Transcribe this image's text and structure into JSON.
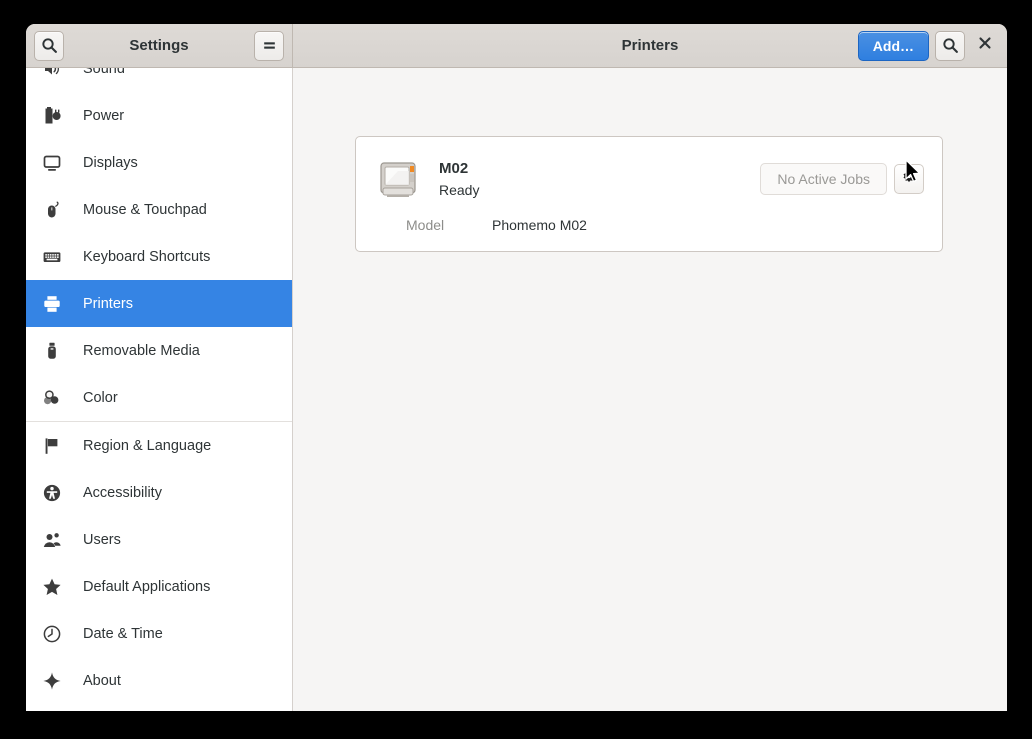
{
  "window": {
    "left_header_title": "Settings",
    "right_header_title": "Printers"
  },
  "header": {
    "search_icon": "search-icon",
    "menu_icon": "hamburger-menu-icon",
    "add_label": "Add…",
    "content_search_icon": "search-icon",
    "close_icon": "close-icon"
  },
  "sidebar": {
    "items": [
      {
        "label": "Sound",
        "icon": "speaker-icon",
        "selected": false
      },
      {
        "label": "Power",
        "icon": "power-plug-icon",
        "selected": false
      },
      {
        "label": "Displays",
        "icon": "monitor-icon",
        "selected": false
      },
      {
        "label": "Mouse & Touchpad",
        "icon": "mouse-icon",
        "selected": false
      },
      {
        "label": "Keyboard Shortcuts",
        "icon": "keyboard-icon",
        "selected": false
      },
      {
        "label": "Printers",
        "icon": "printer-icon",
        "selected": true
      },
      {
        "label": "Removable Media",
        "icon": "usb-drive-icon",
        "selected": false
      },
      {
        "label": "Color",
        "icon": "color-circles-icon",
        "selected": false
      },
      {
        "label": "Region & Language",
        "icon": "flag-icon",
        "selected": false
      },
      {
        "label": "Accessibility",
        "icon": "accessibility-icon",
        "selected": false
      },
      {
        "label": "Users",
        "icon": "users-icon",
        "selected": false
      },
      {
        "label": "Default Applications",
        "icon": "star-icon",
        "selected": false
      },
      {
        "label": "Date & Time",
        "icon": "clock-icon",
        "selected": false
      },
      {
        "label": "About",
        "icon": "sparkle-icon",
        "selected": false
      }
    ],
    "separator_after_index": 7
  },
  "printer": {
    "name": "M02",
    "status": "Ready",
    "jobs_button_label": "No Active Jobs",
    "settings_icon": "gear-icon",
    "printer_icon": "printer-illustration-icon",
    "model_label": "Model",
    "model_value": "Phomemo M02"
  },
  "colors": {
    "accent": "#3584e4",
    "suggested_button": "#3584e4",
    "sidebar_bg": "#ffffff",
    "content_bg": "#f6f5f4",
    "headerbar_bg": "#d7d3cf",
    "card_bg": "#ffffff"
  }
}
